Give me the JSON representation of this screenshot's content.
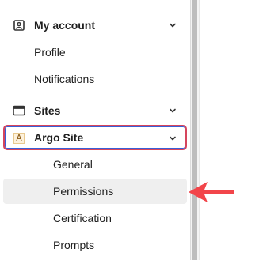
{
  "nav": {
    "my_account": {
      "label": "My account",
      "icon": "user-card-icon"
    },
    "profile": {
      "label": "Profile"
    },
    "notifications": {
      "label": "Notifications"
    },
    "sites": {
      "label": "Sites",
      "icon": "browser-window-icon"
    },
    "argo_site": {
      "label": "Argo Site",
      "icon_letter": "A"
    },
    "general": {
      "label": "General"
    },
    "permissions": {
      "label": "Permissions"
    },
    "certification": {
      "label": "Certification"
    },
    "prompts": {
      "label": "Prompts"
    }
  },
  "colors": {
    "selected_border": "#d6455d",
    "hover_background": "#efefef",
    "arrow": "#f2454a"
  }
}
